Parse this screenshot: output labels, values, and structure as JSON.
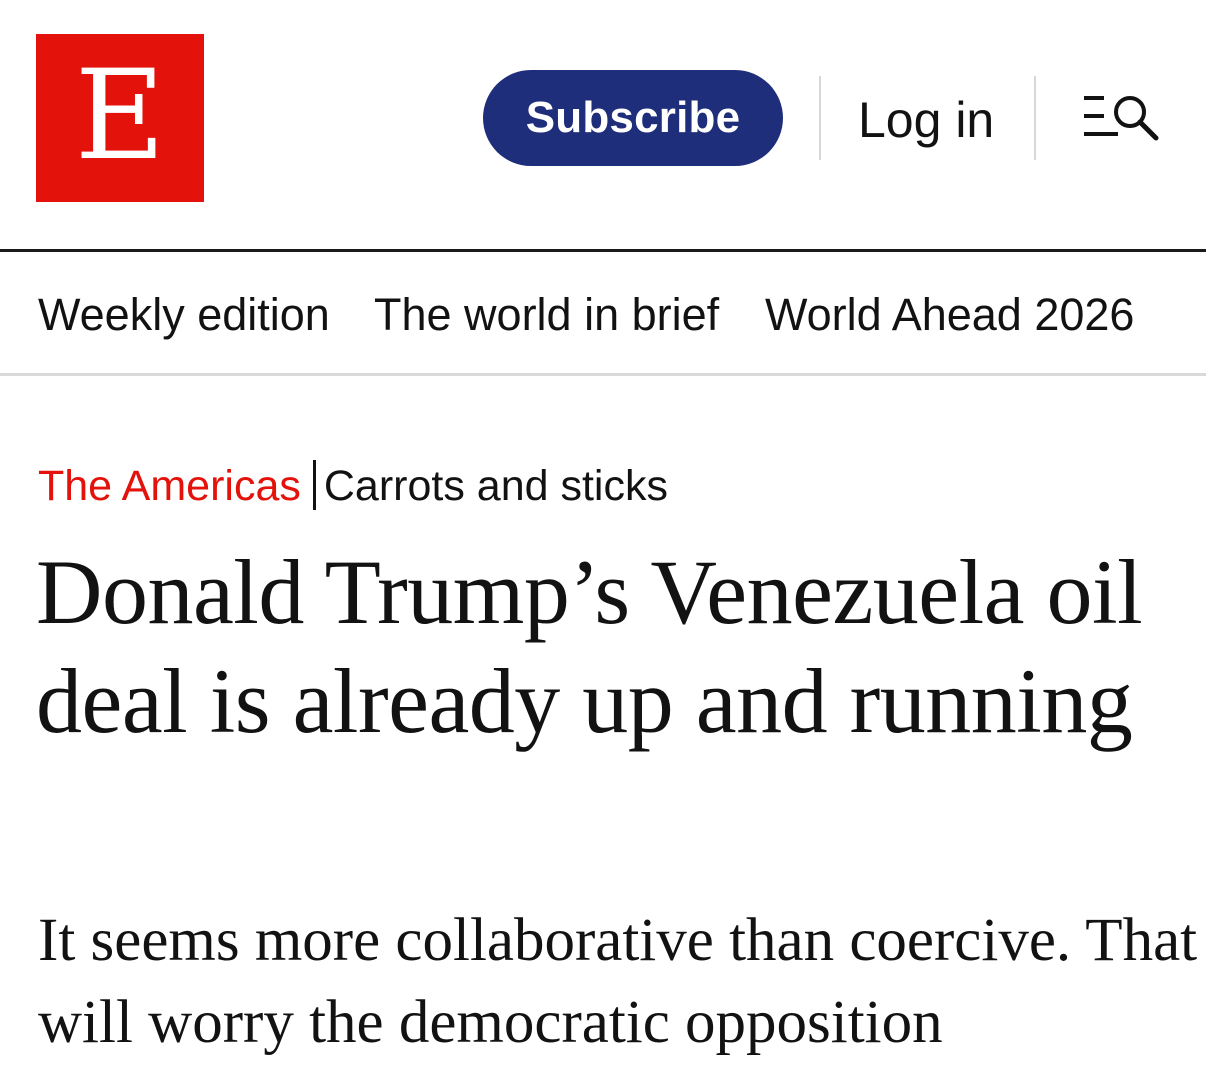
{
  "header": {
    "logo_letter": "E",
    "brand_color": "#e3120b",
    "subscribe_label": "Subscribe",
    "subscribe_color": "#1f2e7a",
    "login_label": "Log in",
    "menu_icon": "menu-search-icon"
  },
  "nav": {
    "items": [
      {
        "label": "Weekly edition"
      },
      {
        "label": "The world in brief"
      },
      {
        "label": "World Ahead 2026"
      }
    ]
  },
  "article": {
    "section": "The Americas",
    "fly_title": "Carrots and sticks",
    "headline": "Donald Trump’s Venezuela oil deal is already up and running",
    "standfirst": "It seems more collaborative than coercive. That will worry the democratic opposition"
  }
}
